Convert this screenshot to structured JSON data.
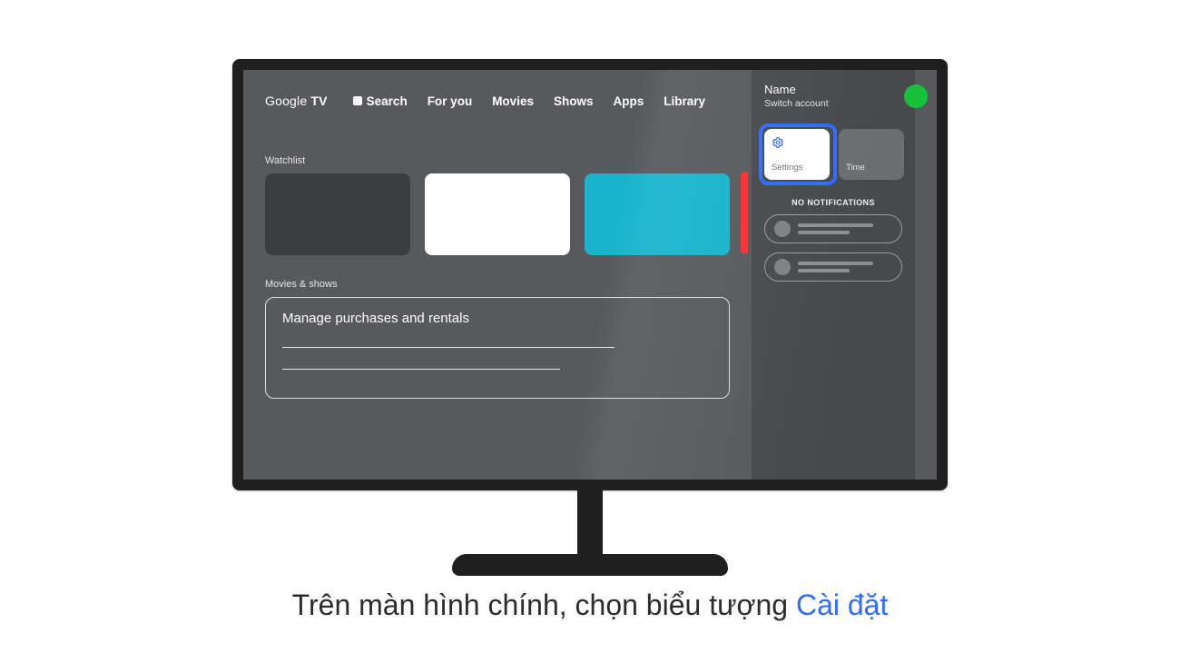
{
  "logo": {
    "brand": "Google",
    "tv": "TV"
  },
  "nav": {
    "search": "Search",
    "foryou": "For you",
    "movies": "Movies",
    "shows": "Shows",
    "apps": "Apps",
    "library": "Library"
  },
  "sections": {
    "watchlist_label": "Watchlist",
    "movies_label": "Movies & shows",
    "manage_text": "Manage purchases and rentals"
  },
  "sidepanel": {
    "account_name": "Name",
    "switch_label": "Switch account",
    "settings_label": "Settings",
    "time_label": "Time",
    "no_notif": "NO NOTIFICATIONS"
  },
  "caption": {
    "pre": "Trên màn hình chính, chọn biểu tượng ",
    "blue": "Cài đặt"
  },
  "colors": {
    "teal": "#17b4cb",
    "accent": "#2f6bff",
    "avatar": "#17c23a",
    "red": "#ff2e2e"
  }
}
